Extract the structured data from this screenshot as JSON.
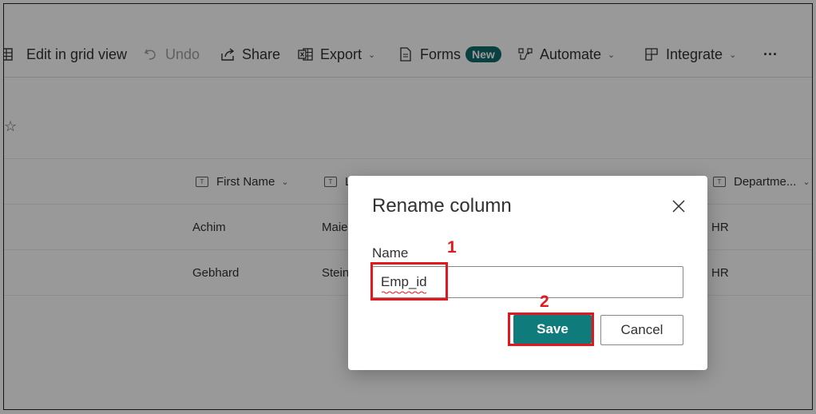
{
  "toolbar": {
    "items": [
      {
        "label": "Edit in grid view",
        "icon": "grid-icon"
      },
      {
        "label": "Undo",
        "icon": "undo-icon",
        "disabled": true
      },
      {
        "label": "Share",
        "icon": "share-icon"
      },
      {
        "label": "Export",
        "icon": "excel-icon",
        "chevron": true
      },
      {
        "label": "Forms",
        "icon": "forms-icon",
        "badge": "New"
      },
      {
        "label": "Automate",
        "icon": "automate-icon",
        "chevron": true
      },
      {
        "label": "Integrate",
        "icon": "integrate-icon",
        "chevron": true
      }
    ],
    "more": "···"
  },
  "favorite_icon": "star-icon",
  "columns": [
    {
      "label": "First Name",
      "chevron": true
    },
    {
      "label": "L",
      "obscured": true
    },
    {
      "label": "",
      "obscured": true
    },
    {
      "label": "",
      "obscured": true
    },
    {
      "label": "Departme...",
      "chevron": true
    }
  ],
  "rows": [
    {
      "first_name": "Achim",
      "last_name": "Maie",
      "department": "HR"
    },
    {
      "first_name": "Gebhard",
      "last_name": "Stein",
      "department": "HR"
    }
  ],
  "dialog": {
    "title": "Rename column",
    "name_label": "Name",
    "name_value": "Emp_id",
    "save_label": "Save",
    "cancel_label": "Cancel"
  },
  "callouts": {
    "step1": "1",
    "step2": "2"
  },
  "colors": {
    "accent": "#0f7b7b",
    "annotation": "#e0181f",
    "badge": "#0f6b6b"
  }
}
